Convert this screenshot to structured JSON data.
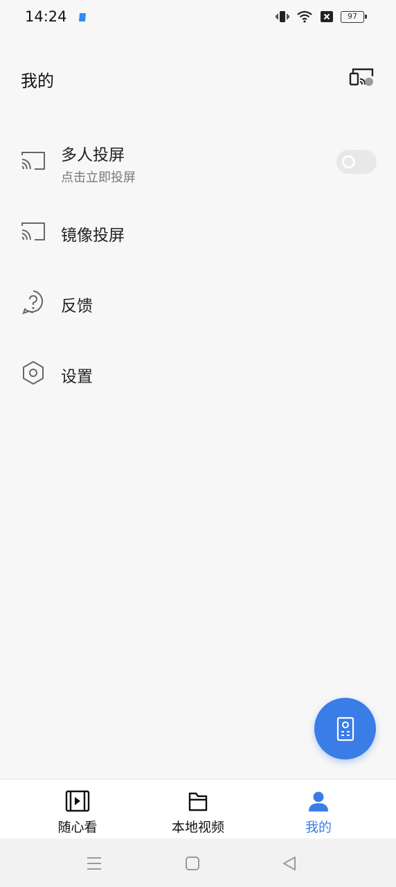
{
  "status_bar": {
    "time": "14:24",
    "battery": "97",
    "icons": [
      "app-notification-icon",
      "vibrate-icon",
      "wifi-icon",
      "no-sim-icon",
      "battery-icon"
    ]
  },
  "header": {
    "title": "我的",
    "action_icon": "cast-device-icon"
  },
  "menu": {
    "items": [
      {
        "label": "多人投屏",
        "sublabel": "点击立即投屏",
        "icon": "cast-icon",
        "toggle_on": false
      },
      {
        "label": "镜像投屏",
        "icon": "cast-icon"
      },
      {
        "label": "反馈",
        "icon": "help-icon"
      },
      {
        "label": "设置",
        "icon": "settings-icon"
      }
    ]
  },
  "fab": {
    "icon": "remote-control-icon"
  },
  "bottom_nav": {
    "items": [
      {
        "label": "随心看",
        "icon": "video-play-icon",
        "active": false
      },
      {
        "label": "本地视频",
        "icon": "folder-icon",
        "active": false
      },
      {
        "label": "我的",
        "icon": "person-icon",
        "active": true
      }
    ]
  },
  "colors": {
    "accent": "#3a7de6",
    "background": "#f7f7f7",
    "text": "#222222",
    "subtext": "#777777"
  }
}
